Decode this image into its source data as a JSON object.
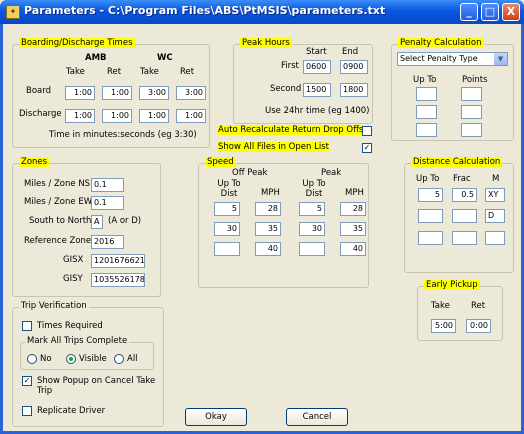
{
  "window": {
    "title": "Parameters - C:\\Program Files\\ABS\\PtMSIS\\parameters.txt",
    "icon": "app-icon",
    "minimize": "_",
    "maximize": "□",
    "close": "X"
  },
  "boarding": {
    "title": "Boarding/Discharge Times",
    "amb": "AMB",
    "wc": "WC",
    "take": "Take",
    "ret": "Ret",
    "board_label": "Board",
    "discharge_label": "Discharge",
    "board": [
      "1:00",
      "1:00",
      "3:00",
      "3:00"
    ],
    "discharge": [
      "1:00",
      "1:00",
      "1:00",
      "1:00"
    ],
    "note": "Time in minutes:seconds (eg 3:30)"
  },
  "peak": {
    "title": "Peak Hours",
    "start": "Start",
    "end": "End",
    "first_label": "First",
    "second_label": "Second",
    "first": [
      "0600",
      "0900"
    ],
    "second": [
      "1500",
      "1800"
    ],
    "note": "Use 24hr time (eg 1400)"
  },
  "penalty": {
    "title": "Penalty Calculation",
    "select": "Select Penalty Type",
    "up_to": "Up To",
    "points": "Points"
  },
  "options": {
    "auto_recalc": "Auto Recalculate Return Drop Offs",
    "auto_recalc_checked": "",
    "show_all": "Show All Files in Open List",
    "show_all_checked": "✓"
  },
  "zones": {
    "title": "Zones",
    "rows": [
      {
        "label": "Miles / Zone NS",
        "value": "0.1"
      },
      {
        "label": "Miles / Zone EW",
        "value": "0.1"
      },
      {
        "label": "South to North",
        "value": "A",
        "hint": "(A or D)"
      },
      {
        "label": "Reference Zone",
        "value": "2016"
      },
      {
        "label": "GISX",
        "value": "1201676621"
      },
      {
        "label": "GISY",
        "value": "1035526178"
      }
    ]
  },
  "speed": {
    "title": "Speed",
    "off_peak": "Off Peak",
    "peak": "Peak",
    "up_to_dist": "Up To Dist",
    "mph": "MPH",
    "rows": [
      [
        "5",
        "28",
        "5",
        "28"
      ],
      [
        "30",
        "35",
        "30",
        "35"
      ],
      [
        "",
        "40",
        "",
        "40"
      ]
    ]
  },
  "distance": {
    "title": "Distance Calculation",
    "up_to": "Up To",
    "frac": "Frac",
    "m": "M",
    "rows": [
      [
        "5",
        "0.5",
        "XY"
      ],
      [
        "",
        "",
        "D"
      ],
      [
        "",
        "",
        ""
      ]
    ]
  },
  "early": {
    "title": "Early Pickup",
    "take": "Take",
    "ret": "Ret",
    "values": [
      "5:00",
      "0:00"
    ]
  },
  "trip": {
    "title": "Trip Verification",
    "times_required": "Times Required",
    "mark_all": "Mark All Trips Complete",
    "no": "No",
    "visible": "Visible",
    "all": "All",
    "selected": "Visible",
    "show_popup": "Show Popup on Cancel Take Trip",
    "show_popup_checked": "✓",
    "replicate": "Replicate Driver"
  },
  "buttons": {
    "okay": "Okay",
    "cancel": "Cancel"
  }
}
